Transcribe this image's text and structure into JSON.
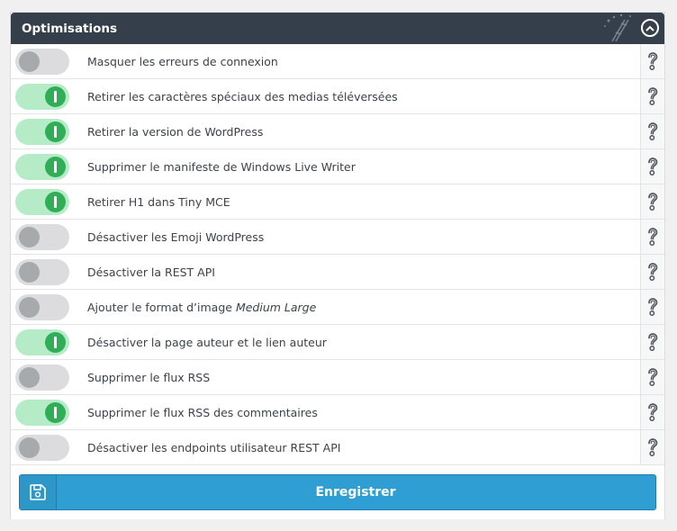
{
  "header": {
    "title": "Optimisations"
  },
  "options": [
    {
      "label": "Masquer les erreurs de connexion",
      "enabled": false
    },
    {
      "label": "Retirer les caractères spéciaux des medias téléversées",
      "enabled": true
    },
    {
      "label": "Retirer la version de WordPress",
      "enabled": true
    },
    {
      "label": "Supprimer le manifeste de Windows Live Writer",
      "enabled": true
    },
    {
      "label": "Retirer H1 dans Tiny MCE",
      "enabled": true
    },
    {
      "label": "Désactiver les Emoji WordPress",
      "enabled": false
    },
    {
      "label": "Désactiver la REST API",
      "enabled": false
    },
    {
      "label": "Ajouter le format d’image ",
      "label_em": "Medium Large",
      "enabled": false
    },
    {
      "label": "Désactiver la page auteur et le lien auteur",
      "enabled": true
    },
    {
      "label": "Supprimer le flux RSS",
      "enabled": false
    },
    {
      "label": "Supprimer le flux RSS des commentaires",
      "enabled": true
    },
    {
      "label": "Désactiver les endpoints utilisateur REST API",
      "enabled": false
    }
  ],
  "footer": {
    "save_label": "Enregistrer"
  },
  "icons": {
    "help": "help-question-icon",
    "collapse": "chevron-up-circle-icon",
    "save": "floppy-disk-icon",
    "decoration": "magic-wand-icon"
  },
  "colors": {
    "header_bg": "#353f4b",
    "toggle_on": "#2fae57",
    "toggle_on_track": "#b6ebc7",
    "toggle_off": "#a7aaad",
    "save_button": "#2f9fd3"
  }
}
